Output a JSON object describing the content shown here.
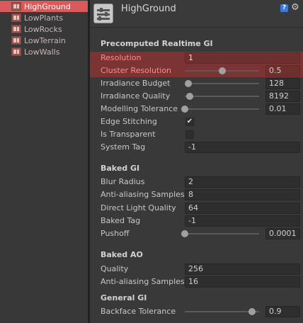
{
  "project": {
    "items": [
      {
        "label": "HighGround",
        "selected": true
      },
      {
        "label": "LowPlants",
        "selected": false
      },
      {
        "label": "LowRocks",
        "selected": false
      },
      {
        "label": "LowTerrain",
        "selected": false
      },
      {
        "label": "LowWalls",
        "selected": false
      }
    ]
  },
  "inspector": {
    "title": "HighGround",
    "help_glyph": "?",
    "gear_glyph": "⚙",
    "sections": {
      "realtime": "Precomputed Realtime GI",
      "baked": "Baked GI",
      "ao": "Baked AO",
      "general": "General GI"
    },
    "rows": {
      "resolution": {
        "label": "Resolution",
        "value": "1"
      },
      "cluster_resolution": {
        "label": "Cluster Resolution",
        "value": "0.5",
        "level": 0.5
      },
      "irradiance_budget": {
        "label": "Irradiance Budget",
        "value": "128",
        "level": 0.05
      },
      "irradiance_quality": {
        "label": "Irradiance Quality",
        "value": "8192",
        "level": 0.07
      },
      "modelling_tolerance": {
        "label": "Modelling Tolerance",
        "value": "0.01",
        "level": 0.0
      },
      "edge_stitching": {
        "label": "Edge Stitching",
        "checked": true,
        "check_glyph": "✔"
      },
      "is_transparent": {
        "label": "Is Transparent",
        "checked": false
      },
      "system_tag": {
        "label": "System Tag",
        "value": "-1"
      },
      "blur_radius": {
        "label": "Blur Radius",
        "value": "2"
      },
      "aa_samples_baked": {
        "label": "Anti-aliasing Samples",
        "value": "8"
      },
      "direct_light_quality": {
        "label": "Direct Light Quality",
        "value": "64"
      },
      "baked_tag": {
        "label": "Baked Tag",
        "value": "-1"
      },
      "pushoff": {
        "label": "Pushoff",
        "value": "0.0001",
        "level": 0.0
      },
      "quality": {
        "label": "Quality",
        "value": "256"
      },
      "aa_samples_ao": {
        "label": "Anti-aliasing Samples",
        "value": "16"
      },
      "backface_tolerance": {
        "label": "Backface Tolerance",
        "value": "0.9",
        "level": 0.9
      }
    }
  },
  "colors": {
    "selected_project_item": "#d85a5a",
    "highlight_row": "#7b3333",
    "highlight_text": "#ff8c8c"
  }
}
